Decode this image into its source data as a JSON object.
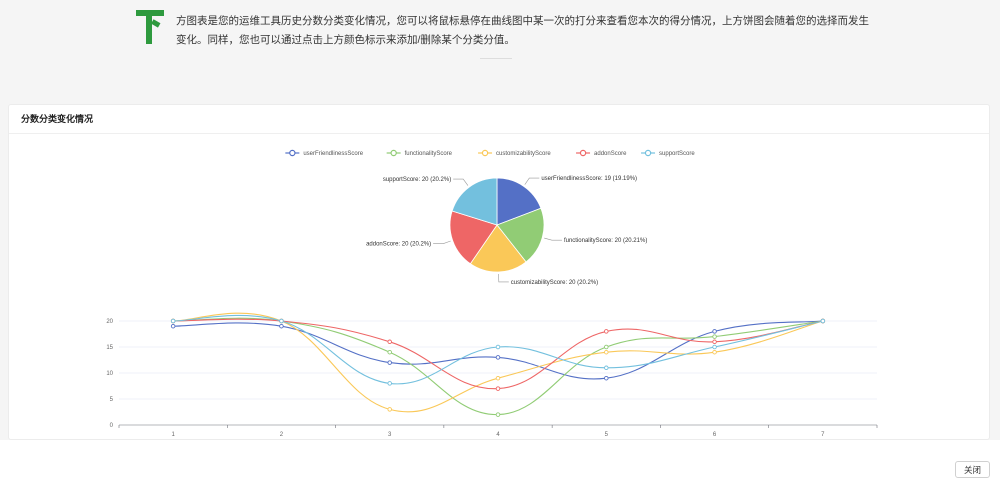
{
  "intro": {
    "text": "方图表是您的运维工具历史分数分类变化情况，您可以将鼠标悬停在曲线图中某一次的打分来查看您本次的得分情况，上方饼图会随着您的选择而发生变化。同样，您也可以通过点击上方颜色标示来添加/删除某个分类分值。",
    "icon_color": "#2e9a3e"
  },
  "card": {
    "title": "分数分类变化情况"
  },
  "footer": {
    "close_label": "关闭"
  },
  "chart_data": {
    "type": "line+pie",
    "legend_position": "top-center",
    "series": [
      {
        "name": "userFriendlinessScore",
        "color": "#5470c6",
        "values": [
          19,
          19,
          12,
          13,
          9,
          18,
          20
        ]
      },
      {
        "name": "functionalityScore",
        "color": "#91cc75",
        "values": [
          20,
          20,
          14,
          2,
          15,
          17,
          20
        ]
      },
      {
        "name": "customizabilityScore",
        "color": "#fac858",
        "values": [
          20,
          20,
          3,
          9,
          14,
          14,
          20
        ]
      },
      {
        "name": "addonScore",
        "color": "#ee6666",
        "values": [
          20,
          20,
          16,
          7,
          18,
          16,
          20
        ]
      },
      {
        "name": "supportScore",
        "color": "#73c0de",
        "values": [
          20,
          20,
          8,
          15,
          11,
          15,
          20
        ]
      }
    ],
    "categories": [
      "1",
      "2",
      "3",
      "4",
      "5",
      "6",
      "7"
    ],
    "ylim": [
      0,
      20
    ],
    "yticks": [
      "0",
      "5",
      "10",
      "15",
      "20"
    ],
    "grid": true,
    "pie": {
      "slices": [
        {
          "name": "userFriendlinessScore",
          "value": 19,
          "label": "userFriendlinessScore: 19 (19.19%)",
          "color": "#5470c6"
        },
        {
          "name": "functionalityScore",
          "value": 20,
          "label": "functionalityScore: 20 (20.21%)",
          "color": "#91cc75"
        },
        {
          "name": "customizabilityScore",
          "value": 20,
          "label": "customizabilityScore: 20 (20.2%)",
          "color": "#fac858"
        },
        {
          "name": "addonScore",
          "value": 20,
          "label": "addonScore: 20 (20.2%)",
          "color": "#ee6666"
        },
        {
          "name": "supportScore",
          "value": 20,
          "label": "supportScore: 20 (20.2%)",
          "color": "#73c0de"
        }
      ]
    }
  }
}
